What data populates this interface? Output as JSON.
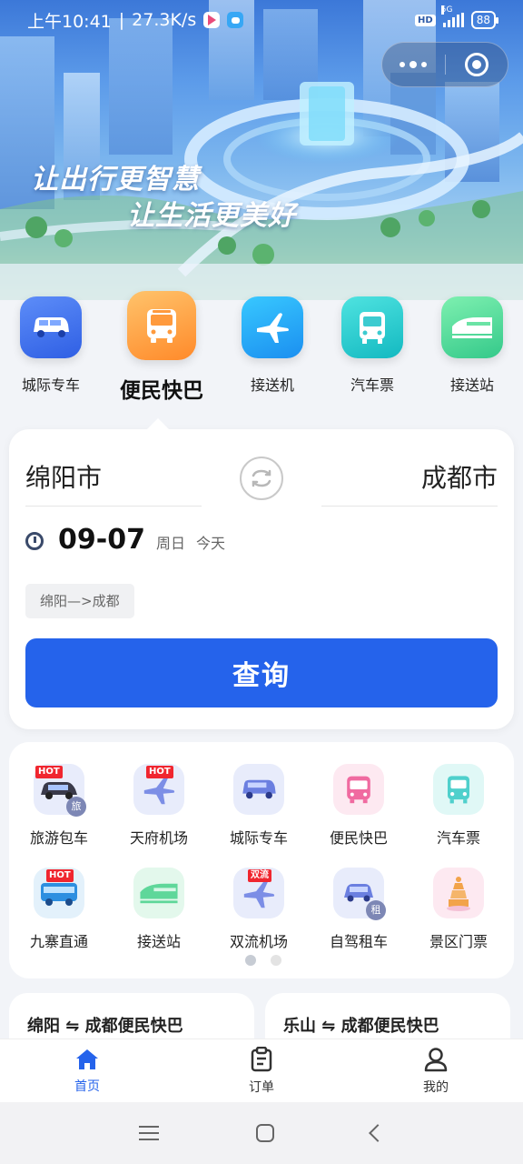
{
  "status_bar": {
    "time": "上午10:41",
    "separator": "|",
    "net_speed": "27.3K/s",
    "hd": "HD",
    "network": "5G",
    "battery": "88"
  },
  "hero": {
    "slogan_line1": "让出行更智慧",
    "slogan_line2": "让生活更美好"
  },
  "categories": [
    {
      "label": "城际专车",
      "icon": "minivan-icon",
      "active": false
    },
    {
      "label": "便民快巴",
      "icon": "bus-icon",
      "active": true
    },
    {
      "label": "接送机",
      "icon": "airplane-icon",
      "active": false
    },
    {
      "label": "汽车票",
      "icon": "coach-bus-icon",
      "active": false
    },
    {
      "label": "接送站",
      "icon": "train-icon",
      "active": false
    }
  ],
  "booking": {
    "from_city": "绵阳市",
    "to_city": "成都市",
    "date": "09-07",
    "weekday": "周日",
    "day_note": "今天",
    "recent_route": "绵阳—>成都",
    "query_button": "查询"
  },
  "services": [
    {
      "label": "旅游包车",
      "icon": "tour-car-icon",
      "badge": "HOT",
      "sub": "旅"
    },
    {
      "label": "天府机场",
      "icon": "airplane-icon",
      "badge": "HOT"
    },
    {
      "label": "城际专车",
      "icon": "minivan-icon"
    },
    {
      "label": "便民快巴",
      "icon": "bus-icon"
    },
    {
      "label": "汽车票",
      "icon": "coach-bus-icon"
    },
    {
      "label": "九寨直通",
      "icon": "tour-bus-icon",
      "badge": "HOT"
    },
    {
      "label": "接送站",
      "icon": "train-icon"
    },
    {
      "label": "双流机场",
      "icon": "airplane-icon",
      "badge": "双流"
    },
    {
      "label": "自驾租车",
      "icon": "rental-car-icon",
      "sub": "租"
    },
    {
      "label": "景区门票",
      "icon": "pagoda-icon"
    }
  ],
  "routes": [
    {
      "title": "绵阳 ⇋ 成都便民快巴"
    },
    {
      "title": "乐山 ⇋ 成都便民快巴"
    }
  ],
  "tabbar": [
    {
      "label": "首页",
      "icon": "home-icon",
      "active": true
    },
    {
      "label": "订单",
      "icon": "clipboard-icon",
      "active": false
    },
    {
      "label": "我的",
      "icon": "user-icon",
      "active": false
    }
  ],
  "colors": {
    "primary": "#2563eb",
    "hot_badge": "#f0262f"
  }
}
